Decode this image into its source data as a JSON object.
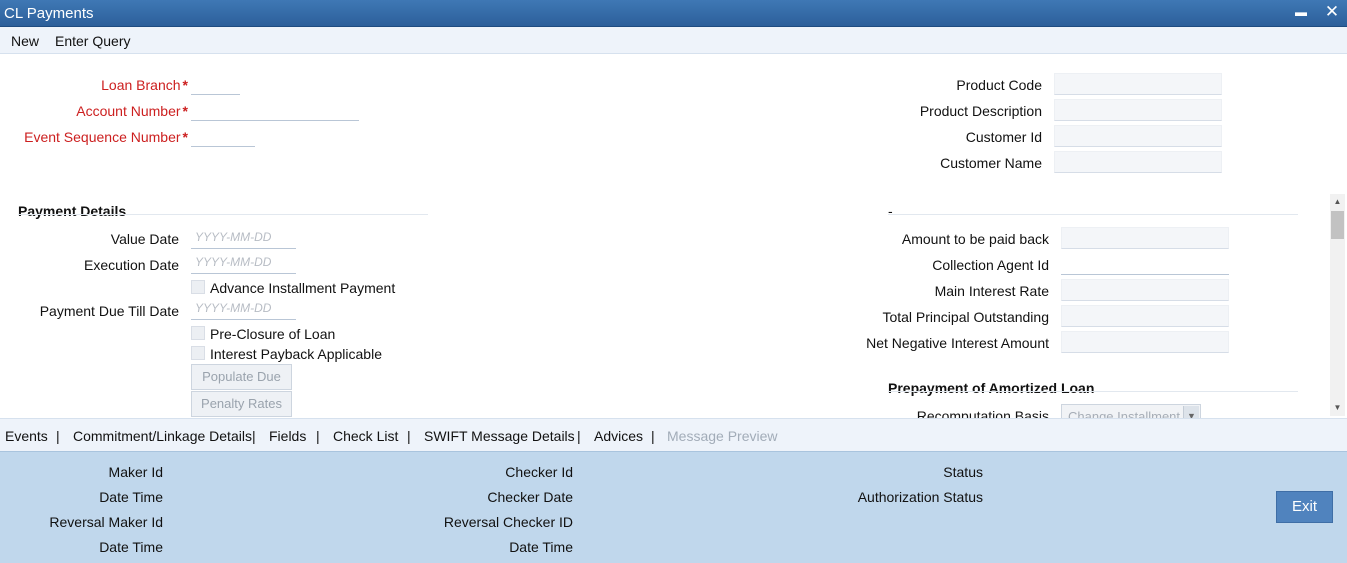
{
  "window": {
    "title": "CL Payments",
    "minimize_glyph": "▬",
    "close_glyph": "✕"
  },
  "menu": {
    "new": "New",
    "enter_query": "Enter Query"
  },
  "header_left": {
    "loan_branch_label": "Loan Branch",
    "account_number_label": "Account Number",
    "event_seq_label": "Event Sequence Number",
    "required_marker": "*"
  },
  "header_right": {
    "product_code_label": "Product Code",
    "product_description_label": "Product Description",
    "customer_id_label": "Customer Id",
    "customer_name_label": "Customer Name"
  },
  "payment_details": {
    "title": "Payment Details",
    "value_date_label": "Value Date",
    "execution_date_label": "Execution Date",
    "advance_installment_label": "Advance Installment Payment",
    "payment_due_till_label": "Payment Due Till Date",
    "preclosure_label": "Pre-Closure of Loan",
    "interest_payback_label": "Interest Payback Applicable",
    "populate_due_button": "Populate Due",
    "penalty_rates_button": "Penalty Rates",
    "date_placeholder": "YYYY-MM-DD"
  },
  "right_section": {
    "title": "-",
    "amount_paid_back_label": "Amount to be paid back",
    "collection_agent_label": "Collection Agent Id",
    "main_interest_rate_label": "Main Interest Rate",
    "total_principal_label": "Total Principal Outstanding",
    "net_negative_interest_label": "Net Negative Interest Amount"
  },
  "prepayment": {
    "title": "Prepayment of Amortized Loan",
    "recomputation_label": "Recomputation Basis",
    "recomputation_value": "Change Installment"
  },
  "tabs": {
    "items": [
      "Events",
      "Commitment/Linkage Details",
      "Fields",
      "Check List",
      "SWIFT Message Details",
      "Advices",
      "Message Preview"
    ],
    "separator": "|"
  },
  "footer": {
    "maker_id": "Maker Id",
    "date_time": "Date Time",
    "reversal_maker_id": "Reversal Maker Id",
    "checker_id": "Checker Id",
    "checker_date": "Checker Date",
    "reversal_checker_id": "Reversal Checker ID",
    "status": "Status",
    "authorization_status": "Authorization Status",
    "exit_button": "Exit"
  },
  "colors": {
    "title_bar": "#2c5f9a",
    "required_text": "#cc1f1f",
    "footer_bg": "#c0d7ec",
    "exit_button": "#5083be"
  }
}
